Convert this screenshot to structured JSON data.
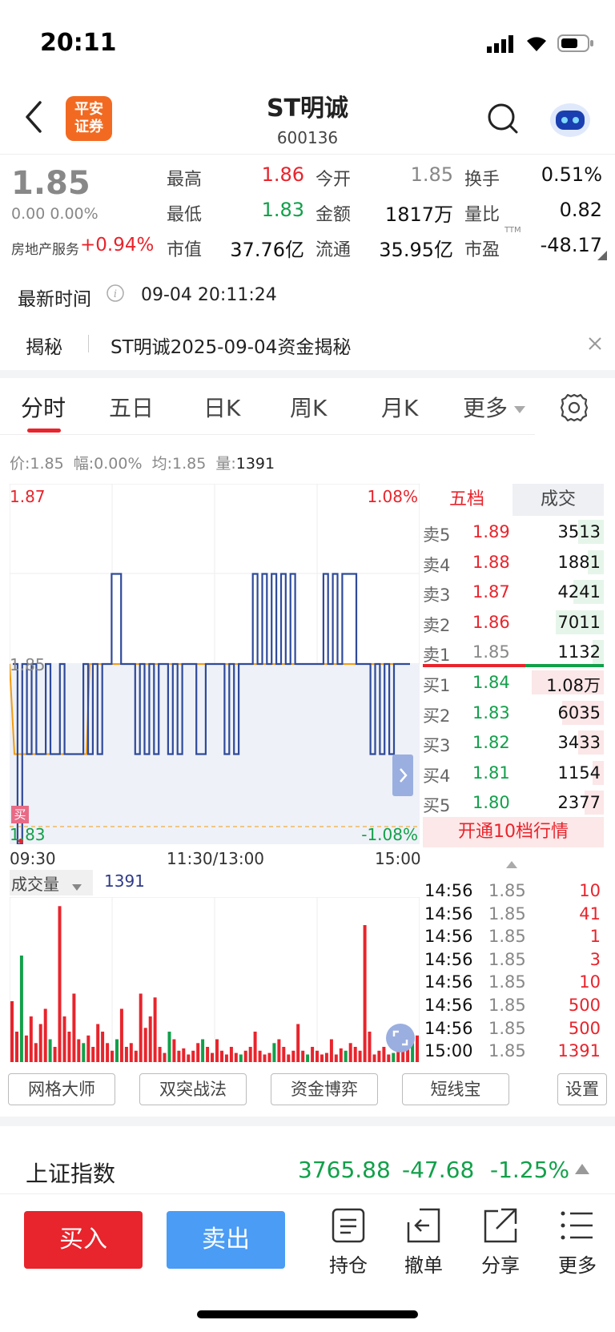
{
  "status": {
    "time": "20:11"
  },
  "header": {
    "title": "ST明诚",
    "code": "600136",
    "logo_text": "平安证券"
  },
  "quote": {
    "price": "1.85",
    "change": "0.00 0.00%",
    "sector": "房地产服务",
    "sector_change": "+0.94%",
    "fields": [
      {
        "label": "最高",
        "value": "1.86"
      },
      {
        "label": "今开",
        "value": "1.85"
      },
      {
        "label": "换手",
        "value": "0.51%"
      },
      {
        "label": "最低",
        "value": "1.83"
      },
      {
        "label": "金额",
        "value": "1817万"
      },
      {
        "label": "量比",
        "value": "0.82"
      },
      {
        "label": "市值",
        "value": "37.76亿"
      },
      {
        "label": "流通",
        "value": "35.95亿"
      },
      {
        "label": "市盈",
        "value": "-48.17"
      }
    ],
    "ttm": "TTM"
  },
  "latest": {
    "label": "最新时间",
    "time": "09-04 20:11:24"
  },
  "reveal": {
    "label": "揭秘",
    "text": "ST明诚2025-09-04资金揭秘"
  },
  "tabs": [
    "分时",
    "五日",
    "日K",
    "周K",
    "月K",
    "更多"
  ],
  "info_line": {
    "price_label": "价:",
    "price": "1.85",
    "range_label": "幅:",
    "range": "0.00%",
    "avg_label": "均:",
    "avg": "1.85",
    "vol_label": "量:",
    "vol": "1391"
  },
  "chart_data": {
    "type": "line",
    "price_top": "1.87",
    "price_mid": "1.85",
    "price_bottom": "1.83",
    "pct_top": "1.08%",
    "pct_bottom": "-1.08%",
    "x_labels": [
      "09:30",
      "11:30/13:00",
      "15:00"
    ],
    "ylim": [
      1.83,
      1.87
    ],
    "buy_marker": "买",
    "volume_label": "成交量",
    "volume_value": "1391",
    "volume_max": "3340"
  },
  "orderbook": {
    "tab_active": "五档",
    "tab_other": "成交",
    "asks": [
      {
        "label": "卖5",
        "price": "1.89",
        "vol": "3513",
        "fill": 0.32
      },
      {
        "label": "卖4",
        "price": "1.88",
        "vol": "1881",
        "fill": 0.2
      },
      {
        "label": "卖3",
        "price": "1.87",
        "vol": "4241",
        "fill": 0.38
      },
      {
        "label": "卖2",
        "price": "1.86",
        "vol": "7011",
        "fill": 0.6
      },
      {
        "label": "卖1",
        "price": "1.85",
        "vol": "1132",
        "fill": 0.14
      }
    ],
    "bids": [
      {
        "label": "买1",
        "price": "1.84",
        "vol": "1.08万",
        "fill": 0.9
      },
      {
        "label": "买2",
        "price": "1.83",
        "vol": "6035",
        "fill": 0.52
      },
      {
        "label": "买3",
        "price": "1.82",
        "vol": "3433",
        "fill": 0.32
      },
      {
        "label": "买4",
        "price": "1.81",
        "vol": "1154",
        "fill": 0.14
      },
      {
        "label": "买5",
        "price": "1.80",
        "vol": "2377",
        "fill": 0.24
      }
    ],
    "upgrade": "开通10档行情"
  },
  "trades": [
    {
      "time": "14:56",
      "price": "1.85",
      "vol": "10"
    },
    {
      "time": "14:56",
      "price": "1.85",
      "vol": "41"
    },
    {
      "time": "14:56",
      "price": "1.85",
      "vol": "1"
    },
    {
      "time": "14:56",
      "price": "1.85",
      "vol": "3"
    },
    {
      "time": "14:56",
      "price": "1.85",
      "vol": "10"
    },
    {
      "time": "14:56",
      "price": "1.85",
      "vol": "500"
    },
    {
      "time": "14:56",
      "price": "1.85",
      "vol": "500"
    },
    {
      "time": "15:00",
      "price": "1.85",
      "vol": "1391"
    }
  ],
  "tools": [
    "网格大师",
    "双突战法",
    "资金博弈",
    "短线宝",
    "设置"
  ],
  "index_bar": {
    "name": "上证指数",
    "value": "3765.88",
    "change": "-47.68",
    "pct": "-1.25%"
  },
  "bottom": {
    "buy": "买入",
    "sell": "卖出",
    "icons": [
      "持仓",
      "撤单",
      "分享",
      "更多"
    ]
  },
  "colors": {
    "up": "#e8242c",
    "down": "#12a04a",
    "line": "#2f4a9a",
    "avg": "#f39c12",
    "sell_btn": "#4a9cf5"
  }
}
